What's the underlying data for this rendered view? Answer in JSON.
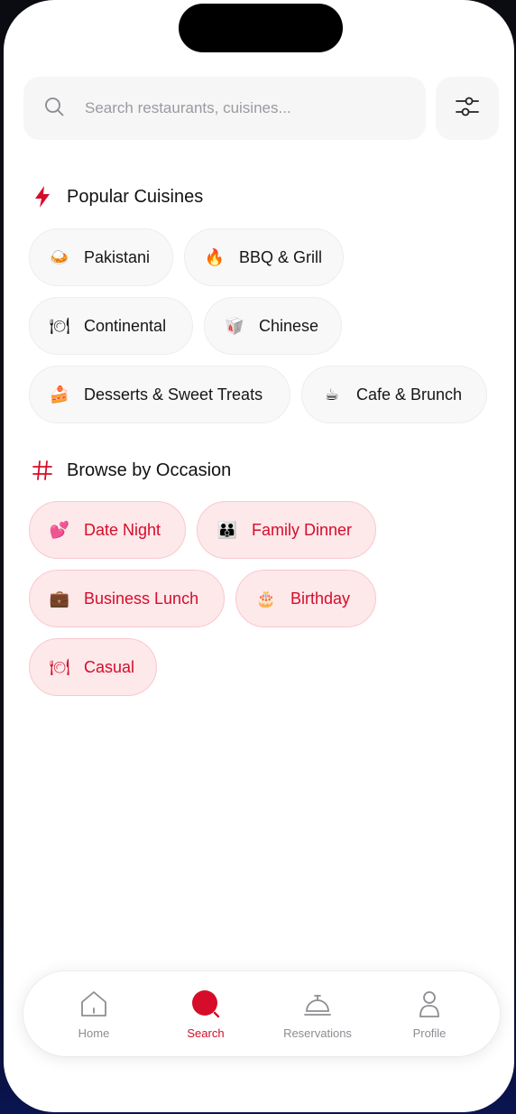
{
  "search": {
    "placeholder": "Search restaurants, cuisines..."
  },
  "sections": {
    "cuisines_title": "Popular Cuisines",
    "occasions_title": "Browse by Occasion"
  },
  "cuisines": [
    {
      "emoji": "🍛",
      "label": "Pakistani"
    },
    {
      "emoji": "🔥",
      "label": "BBQ & Grill"
    },
    {
      "emoji": "🍽",
      "label": "Continental"
    },
    {
      "emoji": "🥡",
      "label": "Chinese"
    },
    {
      "emoji": "🍰",
      "label": "Desserts & Sweet Treats"
    },
    {
      "emoji": "☕",
      "label": "Cafe & Brunch"
    }
  ],
  "occasions": [
    {
      "emoji": "💕",
      "label": "Date Night"
    },
    {
      "emoji": "👪",
      "label": "Family Dinner"
    },
    {
      "emoji": "💼",
      "label": "Business Lunch"
    },
    {
      "emoji": "🎂",
      "label": "Birthday"
    },
    {
      "emoji": "🍽",
      "label": "Casual"
    }
  ],
  "tabbar": {
    "items": [
      {
        "label": "Home",
        "icon": "home-icon",
        "active": false
      },
      {
        "label": "Search",
        "icon": "search-icon",
        "active": true
      },
      {
        "label": "Reservations",
        "icon": "service-bell-icon",
        "active": false
      },
      {
        "label": "Profile",
        "icon": "person-icon",
        "active": false
      }
    ]
  },
  "colors": {
    "accent": "#d50d2a",
    "occasion_chip_bg": "#fde8ea",
    "cuisine_chip_bg": "#f8f8f8"
  }
}
